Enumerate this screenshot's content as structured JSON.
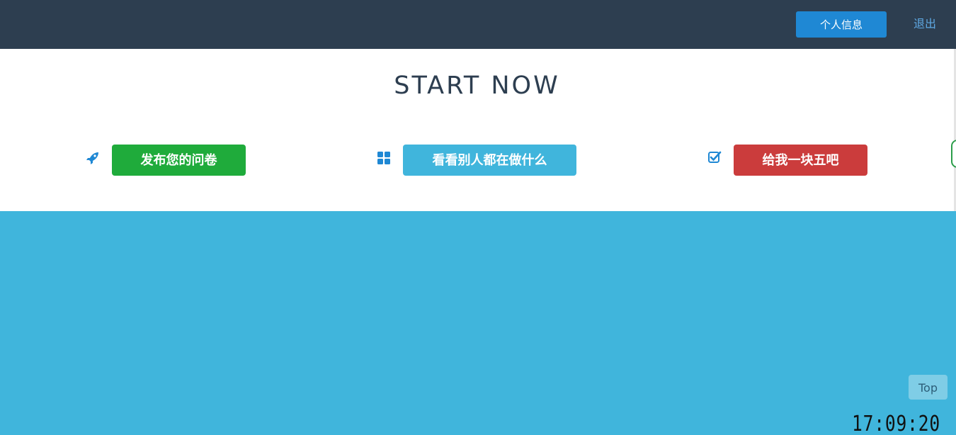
{
  "navbar": {
    "profile_label": "个人信息",
    "logout_label": "退出"
  },
  "hero": {
    "title": "START NOW",
    "actions": [
      {
        "icon": "rocket-icon",
        "label": "发布您的问卷",
        "color": "#1fab3b"
      },
      {
        "icon": "grid-icon",
        "label": "看看别人都在做什么",
        "color": "#40b5dc"
      },
      {
        "icon": "checkbox-icon",
        "label": "给我一块五吧",
        "color": "#cb3c3c"
      }
    ]
  },
  "footer": {
    "top_label": "Top",
    "clock": "17:09:20"
  },
  "colors": {
    "navbar_bg": "#2d3e50",
    "primary_blue": "#1f88d4",
    "section_blue": "#40b5dc"
  }
}
